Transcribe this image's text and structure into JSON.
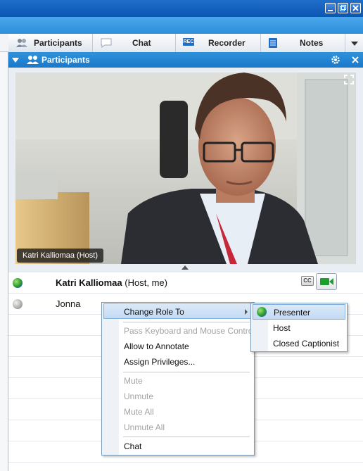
{
  "tabs": [
    {
      "label": "Participants",
      "icon": "participants-icon",
      "active": true
    },
    {
      "label": "Chat",
      "icon": "chat-bubble-icon"
    },
    {
      "label": "Recorder",
      "icon": "rec-icon",
      "icon_text": "REC"
    },
    {
      "label": "Notes",
      "icon": "notes-icon"
    }
  ],
  "panel": {
    "title": "Participants"
  },
  "video": {
    "caption": "Katri Kalliomaa (Host)"
  },
  "participants": [
    {
      "name": "Katri Kalliomaa",
      "suffix": "(Host, me)",
      "status": "presenter-globe"
    },
    {
      "name": "Jonna",
      "status": "idle-grey"
    }
  ],
  "cc_label": "CC",
  "context_menu": {
    "items": [
      {
        "label": "Change Role To",
        "state": "highlighted",
        "submenu": true
      },
      {
        "label": "Pass Keyboard and Mouse Control",
        "state": "disabled"
      },
      {
        "label": "Allow to Annotate",
        "state": "enabled"
      },
      {
        "label": "Assign Privileges...",
        "state": "enabled"
      },
      {
        "label": "Mute",
        "state": "disabled"
      },
      {
        "label": "Unmute",
        "state": "disabled"
      },
      {
        "label": "Mute All",
        "state": "disabled"
      },
      {
        "label": "Unmute All",
        "state": "disabled"
      },
      {
        "label": "Chat",
        "state": "enabled"
      }
    ]
  },
  "submenu": {
    "items": [
      {
        "label": "Presenter",
        "state": "highlighted",
        "icon": "globe-icon"
      },
      {
        "label": "Host",
        "state": "enabled"
      },
      {
        "label": "Closed Captionist",
        "state": "enabled"
      }
    ]
  },
  "colors": {
    "accent": "#1b78c9",
    "titlebar": "#0b56b3",
    "menu_highlight": "#c3daf4"
  }
}
